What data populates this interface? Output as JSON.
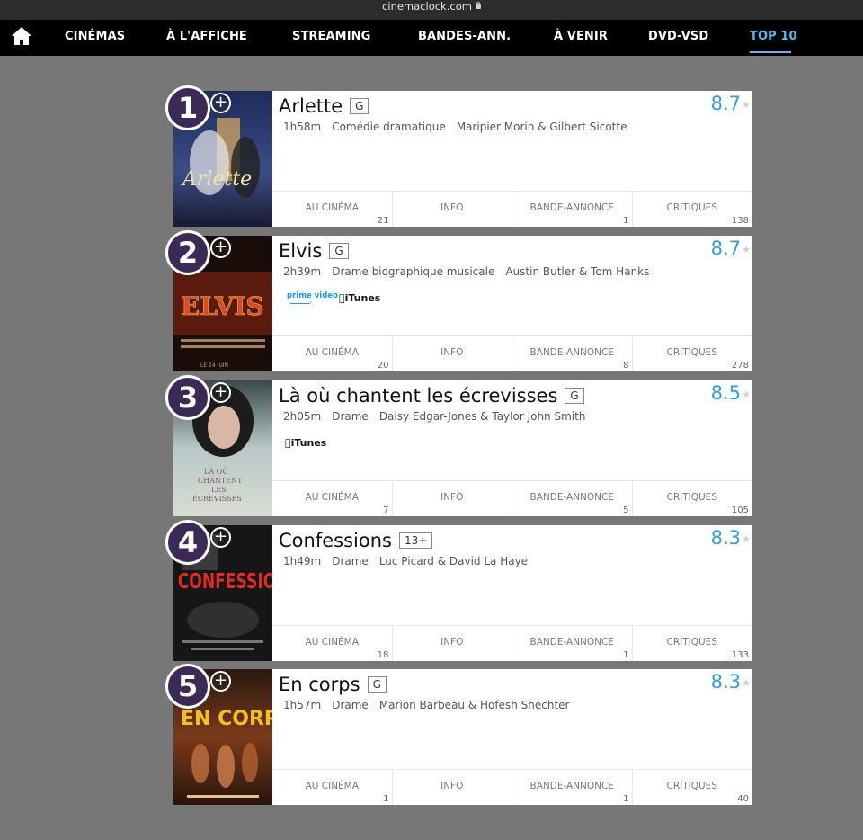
{
  "browser": {
    "url": "cinemaclock.com"
  },
  "nav": {
    "items": [
      "CINÉMAS",
      "À L'AFFICHE",
      "STREAMING",
      "BANDES-ANN.",
      "À VENIR",
      "DVD-VSD",
      "TOP 10"
    ],
    "active": "TOP 10"
  },
  "colors": {
    "accent": "#3a9ad9",
    "nav_active": "#5cb6ec",
    "page_bg": "#777777"
  },
  "actions": [
    "AU CINÉMA",
    "INFO",
    "BANDE-ANNONCE",
    "CRITIQUES"
  ],
  "movies": [
    {
      "rank": "1",
      "title": "Arlette",
      "rating": "G",
      "duration": "1h58m",
      "genre": "Comédie dramatique",
      "cast": "Maripier Morin & Gilbert Sicotte",
      "score": "8.7",
      "streaming": [],
      "counts": [
        "21",
        "",
        "1",
        "138"
      ]
    },
    {
      "rank": "2",
      "title": "Elvis",
      "rating": "G",
      "duration": "2h39m",
      "genre": "Drame biographique musicale",
      "cast": "Austin Butler & Tom Hanks",
      "score": "8.7",
      "streaming": [
        "prime video",
        "iTunes"
      ],
      "counts": [
        "20",
        "",
        "8",
        "278"
      ]
    },
    {
      "rank": "3",
      "title": "Là où chantent les écrevisses",
      "rating": "G",
      "duration": "2h05m",
      "genre": "Drame",
      "cast": "Daisy Edgar-Jones & Taylor John Smith",
      "score": "8.5",
      "streaming": [
        "iTunes"
      ],
      "counts": [
        "7",
        "",
        "5",
        "105"
      ]
    },
    {
      "rank": "4",
      "title": "Confessions",
      "rating": "13+",
      "duration": "1h49m",
      "genre": "Drame",
      "cast": "Luc Picard & David La Haye",
      "score": "8.3",
      "streaming": [],
      "counts": [
        "18",
        "",
        "1",
        "133"
      ]
    },
    {
      "rank": "5",
      "title": "En corps",
      "rating": "G",
      "duration": "1h57m",
      "genre": "Drame",
      "cast": "Marion Barbeau & Hofesh Shechter",
      "score": "8.3",
      "streaming": [],
      "counts": [
        "1",
        "",
        "1",
        "40"
      ]
    }
  ]
}
